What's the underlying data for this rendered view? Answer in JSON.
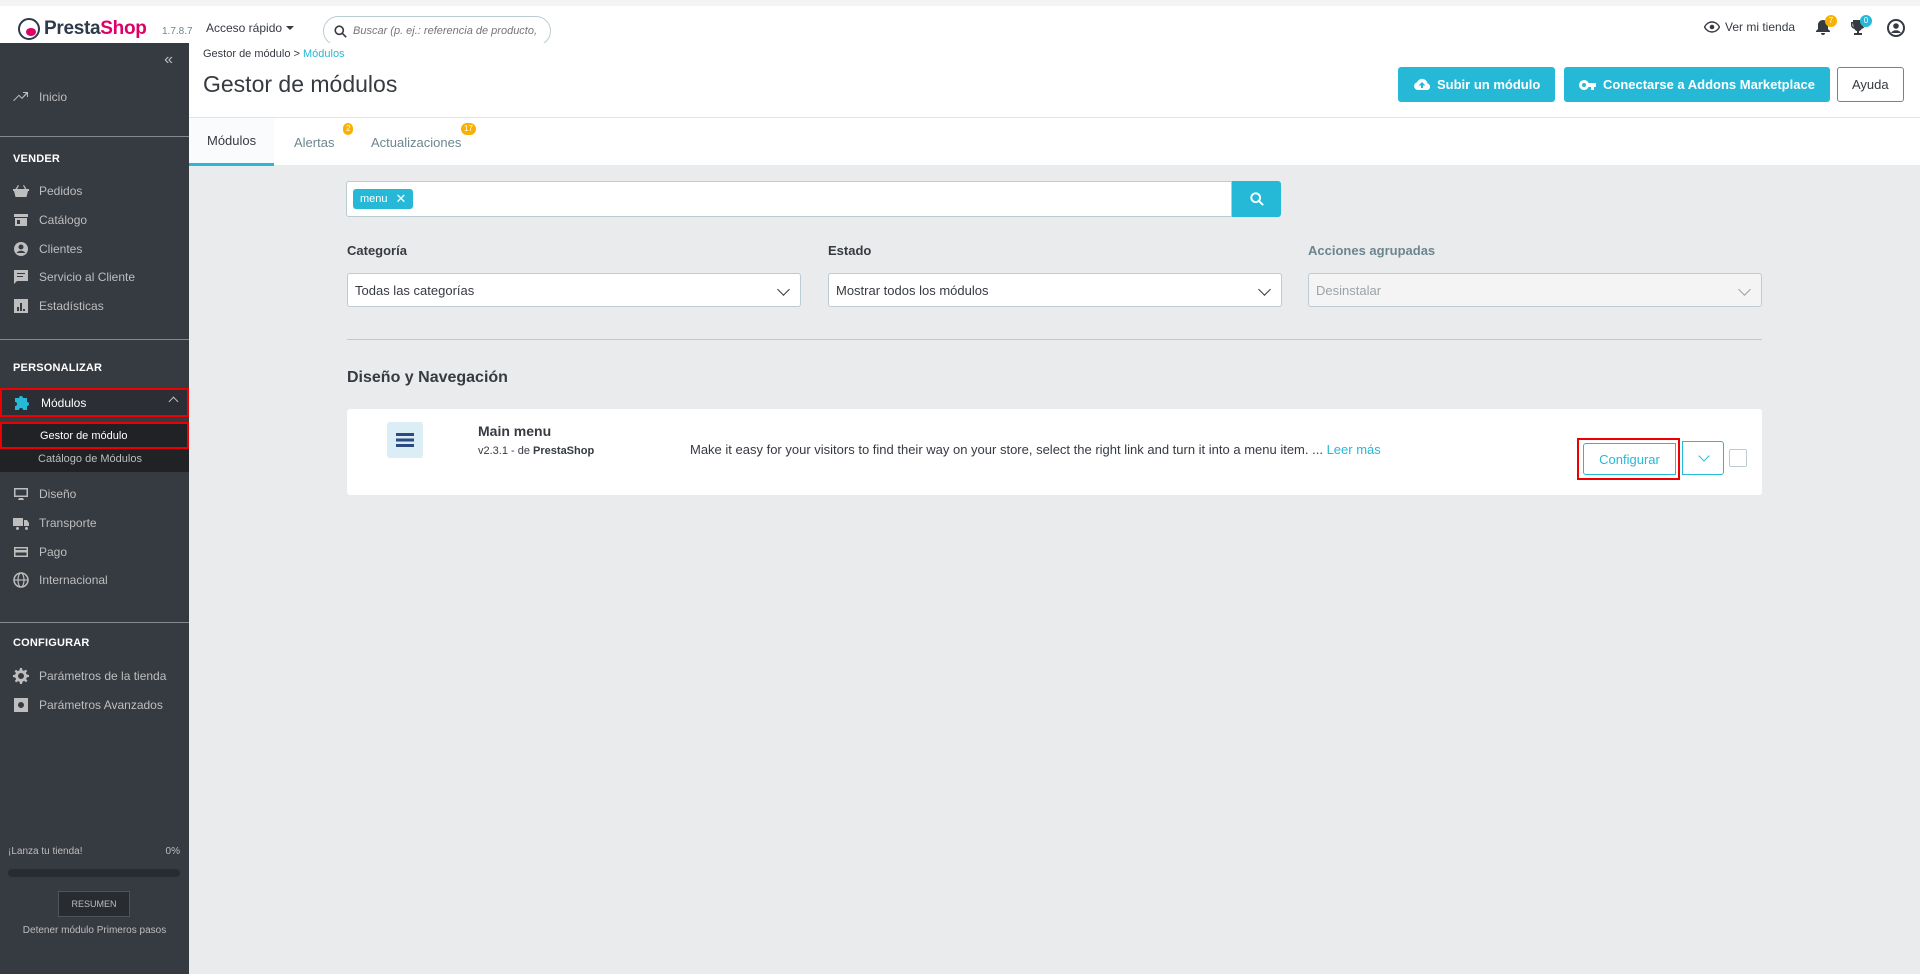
{
  "header": {
    "logo_text": "PrestaShop",
    "version": "1.7.8.7",
    "quick_access": "Acceso rápido",
    "search_placeholder": "Buscar (p. ej.: referencia de producto,",
    "view_store": "Ver mi tienda",
    "notif_count": "7",
    "trophy_count": "0"
  },
  "sidebar": {
    "inicio": "Inicio",
    "sections": {
      "vender": "VENDER",
      "personalizar": "PERSONALIZAR",
      "configurar": "CONFIGURAR"
    },
    "vender_items": [
      "Pedidos",
      "Catálogo",
      "Clientes",
      "Servicio al Cliente",
      "Estadísticas"
    ],
    "modulos": "Módulos",
    "sub_items": [
      "Gestor de módulo",
      "Catálogo de Módulos"
    ],
    "personalizar_items": [
      "Diseño",
      "Transporte",
      "Pago",
      "Internacional"
    ],
    "configurar_items": [
      "Parámetros de la tienda",
      "Parámetros Avanzados"
    ],
    "launch_label": "¡Lanza tu tienda!",
    "launch_percent": "0%",
    "launch_progress": 0,
    "resumen": "RESUMEN",
    "detener": "Detener módulo Primeros pasos"
  },
  "page": {
    "breadcrumb_parent": "Gestor de módulo",
    "breadcrumb_current": "Módulos",
    "title": "Gestor de módulos",
    "btn_upload": "Subir un módulo",
    "btn_addons": "Conectarse a Addons Marketplace",
    "btn_help": "Ayuda"
  },
  "tabs": {
    "modulos": "Módulos",
    "alertas": "Alertas",
    "alertas_count": "2",
    "actualizaciones": "Actualizaciones",
    "actualizaciones_count": "17"
  },
  "filters": {
    "search_tag": "menu",
    "categoria_label": "Categoría",
    "categoria_value": "Todas las categorías",
    "estado_label": "Estado",
    "estado_value": "Mostrar todos los módulos",
    "acciones_label": "Acciones agrupadas",
    "acciones_value": "Desinstalar"
  },
  "category": {
    "title": "Diseño y Navegación"
  },
  "module": {
    "name": "Main menu",
    "version": "v2.3.1 - de",
    "author": "PrestaShop",
    "description": "Make it easy for your visitors to find their way on your store, select the right link and turn it into a menu item. ...",
    "read_more": "Leer más",
    "configure": "Configurar"
  },
  "colors": {
    "accent": "#25b9d7",
    "brand_pink": "#df0067",
    "sidebar_bg": "#363a41",
    "highlight_border": "#ee0000",
    "badge": "#fab000"
  }
}
